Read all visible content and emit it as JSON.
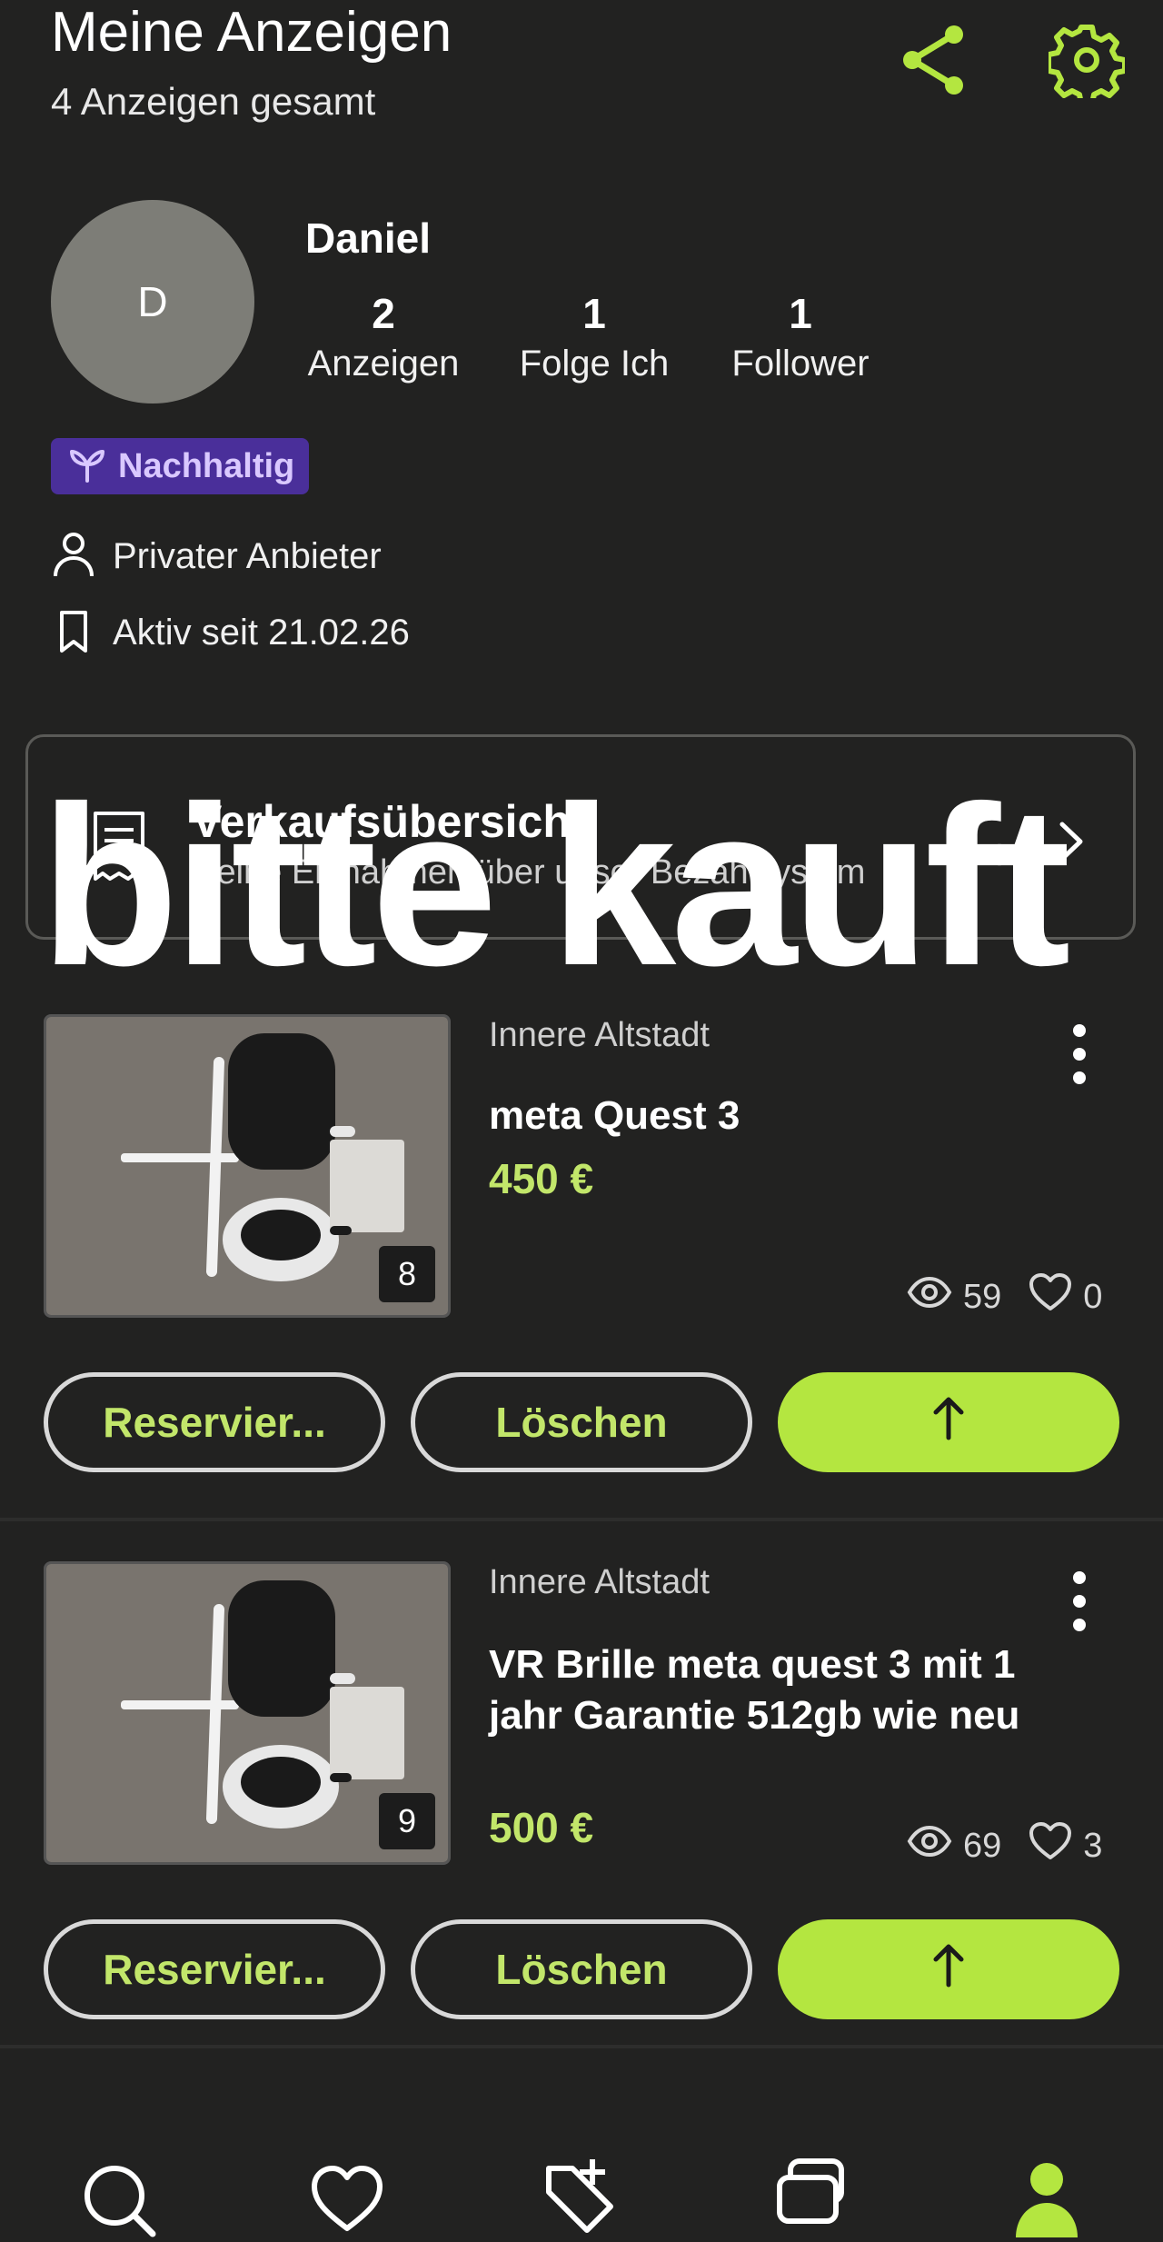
{
  "header": {
    "title": "Meine Anzeigen",
    "subtitle": "4 Anzeigen gesamt",
    "share_icon": "share-icon",
    "settings_icon": "gear-icon"
  },
  "profile": {
    "avatar_letter": "D",
    "name": "Daniel",
    "stats": [
      {
        "value": "2",
        "label": "Anzeigen"
      },
      {
        "value": "1",
        "label": "Folge Ich"
      },
      {
        "value": "1",
        "label": "Follower"
      }
    ],
    "badge": "Nachhaltig",
    "seller_type": "Privater Anbieter",
    "active_since": "Aktiv seit 21.02.26"
  },
  "sales_overview": {
    "title": "Verkaufsübersicht",
    "description": "Deine Einnahmen über unser Bezahlsystem"
  },
  "overlay_caption": "bitte kauft",
  "listings": [
    {
      "location": "Innere Altstadt",
      "title": "meta Quest 3",
      "price": "450 €",
      "image_count": "8",
      "views": "59",
      "likes": "0",
      "reserve_label": "Reservier...",
      "delete_label": "Löschen"
    },
    {
      "location": "Innere Altstadt",
      "title": "VR Brille meta quest 3 mit 1 jahr Garantie  512gb wie neu",
      "price": "500 €",
      "image_count": "9",
      "views": "69",
      "likes": "3",
      "reserve_label": "Reservier...",
      "delete_label": "Löschen"
    }
  ],
  "bottom_nav": [
    "search-icon",
    "heart-icon",
    "add-listing-icon",
    "chat-icon",
    "profile-icon"
  ],
  "colors": {
    "background": "#222221",
    "accent": "#b4e640",
    "price": "#c2e66a",
    "badge_bg": "#4a2f9a",
    "badge_text": "#d9c8ff"
  }
}
